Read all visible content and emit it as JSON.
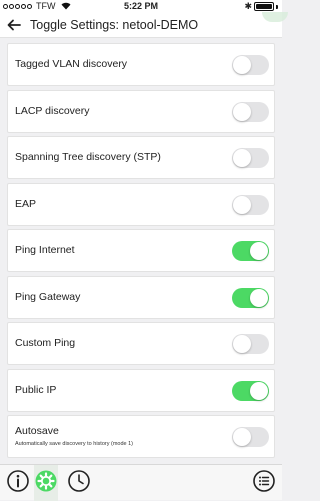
{
  "status_bar": {
    "signal_dots": [
      false,
      false,
      false,
      false,
      false
    ],
    "carrier": "TFW",
    "time": "5:22 PM",
    "bluetooth": "✱",
    "battery_level": 1.0
  },
  "header": {
    "back_icon": "back-arrow-icon",
    "title": "Toggle Settings: netool-DEMO"
  },
  "settings": [
    {
      "label": "Tagged VLAN discovery",
      "on": false
    },
    {
      "label": "LACP discovery",
      "on": false
    },
    {
      "label": "Spanning Tree discovery (STP)",
      "on": false
    },
    {
      "label": "EAP",
      "on": false
    },
    {
      "label": "Ping Internet",
      "on": true
    },
    {
      "label": "Ping Gateway",
      "on": true
    },
    {
      "label": "Custom Ping",
      "on": false
    },
    {
      "label": "Public IP",
      "on": true
    },
    {
      "label": "Autosave",
      "sublabel": "Automatically save discovery to history (mode 1)",
      "on": false
    }
  ],
  "tab_bar": {
    "tabs": [
      "info-icon",
      "gear-icon",
      "clock-icon",
      "list-icon"
    ],
    "active_tab": "gear-icon",
    "colors": {
      "active": "#4cd964",
      "inactive": "#222222"
    }
  },
  "colors": {
    "toggle_on": "#4cd964",
    "toggle_off": "#e3e3e5",
    "background": "#f0f0f2"
  }
}
